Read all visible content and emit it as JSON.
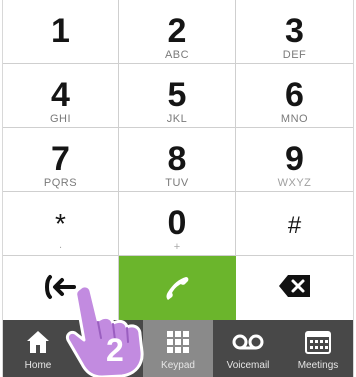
{
  "keypad": {
    "keys": [
      {
        "digit": "1",
        "letters": ""
      },
      {
        "digit": "2",
        "letters": "ABC"
      },
      {
        "digit": "3",
        "letters": "DEF"
      },
      {
        "digit": "4",
        "letters": "GHI"
      },
      {
        "digit": "5",
        "letters": "JKL"
      },
      {
        "digit": "6",
        "letters": "MNO"
      },
      {
        "digit": "7",
        "letters": "PQRS"
      },
      {
        "digit": "8",
        "letters": "TUV"
      },
      {
        "digit": "9",
        "letters": "WXYZ"
      },
      {
        "digit": "*",
        "letters": "."
      },
      {
        "digit": "0",
        "letters": "+"
      },
      {
        "digit": "#",
        "letters": ""
      }
    ],
    "call_color": "#6bb52c"
  },
  "actions": {
    "transfer_icon": "call-transfer-icon",
    "call_icon": "phone-handset-icon",
    "backspace_icon": "backspace-icon"
  },
  "tabbar": {
    "background": "#484848",
    "active_background": "#8a8a8a",
    "tabs": [
      {
        "label": "Home",
        "icon": "home-icon"
      },
      {
        "label": "Keypad",
        "icon": "keypad-icon"
      },
      {
        "label": "Voicemail",
        "icon": "voicemail-icon"
      },
      {
        "label": "Meetings",
        "icon": "calendar-icon"
      }
    ]
  },
  "annotation": {
    "step_number": "2",
    "hand_color": "#c28be0"
  }
}
